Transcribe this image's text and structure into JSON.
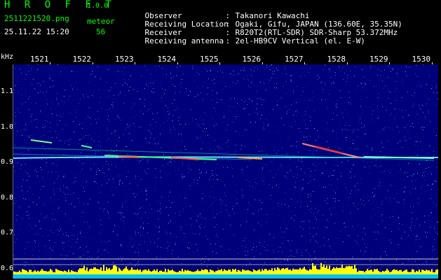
{
  "header": {
    "app_title": "H R O F F T",
    "app_version": "1.0.0",
    "file_name": "2511221520.png",
    "mode": "meteor",
    "date_time": "25.11.22 15:20",
    "count": "56"
  },
  "info": [
    {
      "key": "Observer",
      "value": "Takanori Kawachi"
    },
    {
      "key": "Receiving Location",
      "value": "Ogaki, Gifu, JAPAN (136.60E, 35.35N)"
    },
    {
      "key": "Receiver",
      "value": "R820T2(RTL-SDR) SDR-Sharp 53.372MHz"
    },
    {
      "key": "Receiving antenna",
      "value": "2el-HB9CV Vertical (el. E-W)"
    }
  ],
  "time_axis": [
    "1521",
    "1522",
    "1523",
    "1524",
    "1525",
    "1526",
    "1527",
    "1528",
    "1529",
    "1530"
  ],
  "freq_axis": {
    "unit": "kHz",
    "labels": [
      "1.1",
      "1.0",
      "0.9",
      "0.8",
      "0.7",
      "0.6"
    ]
  },
  "colors": {
    "background_noise": "#00008b",
    "carrier": "#66e0ff",
    "meteor_head": "#ff3030",
    "level_bars": "#ffff00",
    "level_baseline": "#00c0ff",
    "text_green": "#00ff00"
  }
}
